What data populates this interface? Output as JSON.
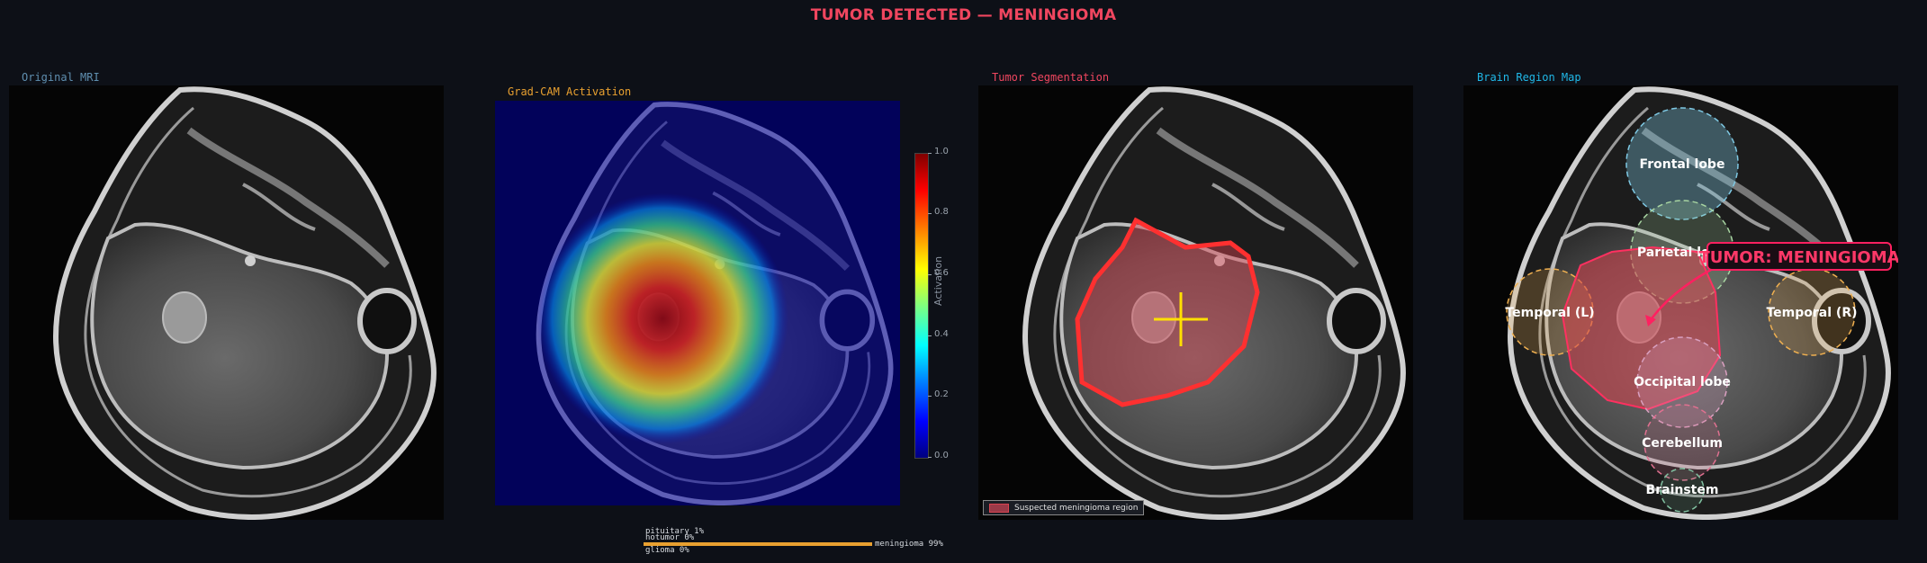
{
  "header": {
    "title": "TUMOR DETECTED — MENINGIOMA",
    "title_color": "#f0465f"
  },
  "panels": {
    "original": {
      "title": "Original MRI",
      "color": "#5f8fb0"
    },
    "gradcam": {
      "title": "Grad-CAM Activation",
      "color": "#e8a030"
    },
    "segmentation": {
      "title": "Tumor Segmentation",
      "color": "#f0465f"
    },
    "regionmap": {
      "title": "Brain Region Map",
      "color": "#20b8e8"
    }
  },
  "colorbar": {
    "label": "Activation",
    "ticks": [
      "0.0",
      "0.2",
      "0.4",
      "0.6",
      "0.8",
      "1.0"
    ],
    "colormap": "jet"
  },
  "probabilities": [
    {
      "label": "glioma 0%",
      "value": 0.0
    },
    {
      "label": "meningioma 99%",
      "value": 0.99
    },
    {
      "label": "notumor 0%",
      "value": 0.0
    },
    {
      "label": "pituitary 1%",
      "value": 0.01
    }
  ],
  "probability_bar_color": "#e8a030",
  "legend": {
    "label": "Suspected meningioma region",
    "color": "#d9434f"
  },
  "regions": [
    {
      "label": "Frontal lobe",
      "color": "#7ec8e3"
    },
    {
      "label": "Parietal lobe",
      "color": "#a8d5a2"
    },
    {
      "label": "Temporal (L)",
      "color": "#f0b050"
    },
    {
      "label": "Temporal (R)",
      "color": "#f0b050"
    },
    {
      "label": "Occipital lobe",
      "color": "#d9a0c0"
    },
    {
      "label": "Cerebellum",
      "color": "#e07090"
    },
    {
      "label": "Brainstem",
      "color": "#80c0a0"
    }
  ],
  "tumor_callout": {
    "label": "TUMOR: MENINGIOMA",
    "color": "#f0465f"
  }
}
